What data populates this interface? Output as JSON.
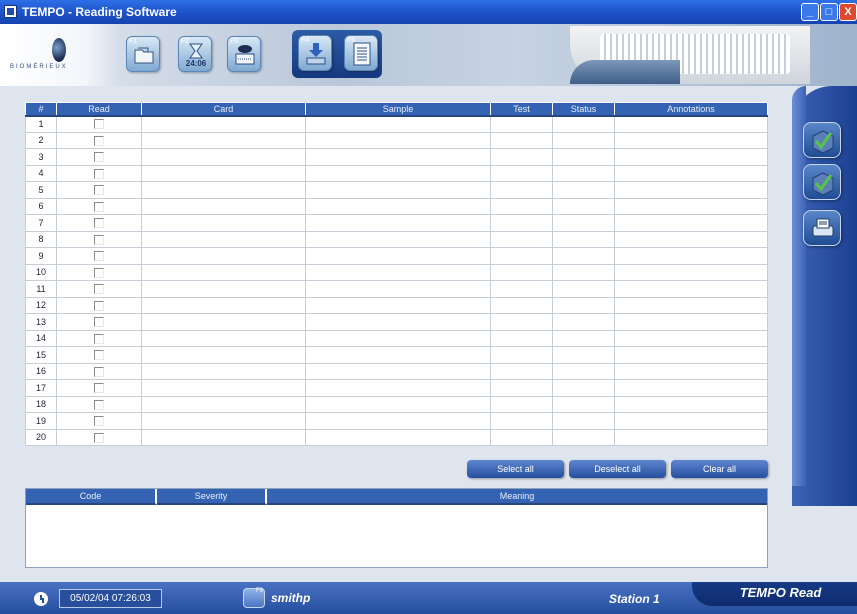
{
  "window": {
    "title": "TEMPO - Reading Software",
    "controls": [
      "_",
      "□",
      "X"
    ]
  },
  "logo": {
    "text": "BIOMÉRIEUX"
  },
  "toolbar": {
    "buttons": [
      {
        "key": "F1",
        "icon": "folder-icon"
      },
      {
        "key": "F2",
        "icon": "hourglass-icon",
        "time": "24:06"
      },
      {
        "key": "F3",
        "icon": "scanner-icon"
      },
      {
        "key": "F4",
        "icon": "download-icon"
      },
      {
        "key": "F5",
        "icon": "document-icon"
      }
    ]
  },
  "grid": {
    "columns": [
      "#",
      "Read",
      "Card",
      "Sample",
      "Test",
      "Status",
      "Annotations"
    ],
    "rows": [
      "1",
      "2",
      "3",
      "4",
      "5",
      "6",
      "7",
      "8",
      "9",
      "10",
      "11",
      "12",
      "13",
      "14",
      "15",
      "16",
      "17",
      "18",
      "19",
      "20"
    ]
  },
  "actions": {
    "select_all": "Select all",
    "deselect_all": "Deselect all",
    "clear_all": "Clear all"
  },
  "messages": {
    "columns": [
      "Code",
      "Severity",
      "Meaning"
    ]
  },
  "status": {
    "datetime": "05/02/04 07:26:03",
    "user_key": "F9",
    "user": "smithp",
    "station": "Station 1",
    "product": "TEMPO Read"
  },
  "colors": {
    "accent": "#3463b3",
    "status_bar": "#244e9e",
    "title_bar": "#1b4fc4"
  }
}
